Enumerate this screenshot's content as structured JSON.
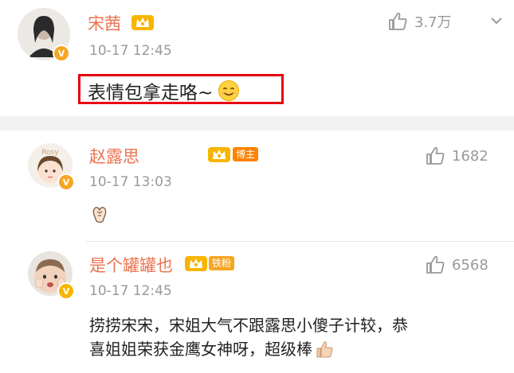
{
  "post": {
    "author": "宋茜",
    "time": "10-17 12:45",
    "text": "表情包拿走咯~",
    "likes": "3.7万"
  },
  "comments": [
    {
      "author": "赵露思",
      "tag": "博主",
      "time": "10-17 13:03",
      "likes": "1682",
      "avatar_text": "Rosy"
    },
    {
      "author": "是个罐罐也",
      "tag": "铁粉",
      "time": "10-17 12:45",
      "likes": "6568",
      "text_line1": "捞捞宋宋，宋姐大气不跟露思小傻子计较，恭",
      "text_line2": "喜姐姐荣获金鹰女神呀，超级棒"
    }
  ],
  "icons": {
    "verified": "V"
  },
  "colors": {
    "name": "#eb7350",
    "highlight_box": "#e60012",
    "tag_boss": "#ff8200",
    "tag_fan": "#f5a623"
  }
}
